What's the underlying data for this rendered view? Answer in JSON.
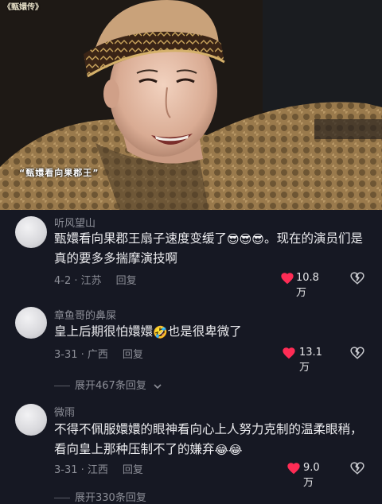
{
  "video": {
    "watermark": "《甄嬛传》",
    "caption": "“甄嬛看向果郡王”"
  },
  "comments": [
    {
      "username": "听风望山",
      "text_parts": [
        "甄嬛看向果郡王扇子速度变缓了",
        "。现在的演员们是真的要多多揣摩演技啊"
      ],
      "emojis": [
        "😎",
        "😎",
        "😎"
      ],
      "date_location": "4-2 · 江苏",
      "reply_label": "回复",
      "likes": "10.8万"
    },
    {
      "username": "章鱼哥的鼻屎",
      "text_parts": [
        "皇上后期很怕嬛嬛",
        "也是很卑微了"
      ],
      "emojis": [
        "🤣"
      ],
      "date_location": "3-31 · 广西",
      "reply_label": "回复",
      "likes": "13.1万",
      "expand_label": "展开467条回复"
    },
    {
      "username": "微雨",
      "text_parts": [
        "不得不佩服嬛嬛的眼神看向心上人努力克制的温柔眼稍，看向皇上那种压制不了的嫌弃",
        ""
      ],
      "emojis": [
        "😂",
        "😂"
      ],
      "date_location": "3-31 · 江西",
      "reply_label": "回复",
      "likes": "9.0万",
      "expand_label": "展开330条回复"
    }
  ],
  "icons": {
    "liked_heart": "heart-filled-icon",
    "dislike": "broken-heart-icon",
    "expand_chevron": "chevron-down-icon"
  },
  "colors": {
    "background": "#161823",
    "heart": "#fe2c55",
    "secondary_text": "#8c8e97"
  }
}
